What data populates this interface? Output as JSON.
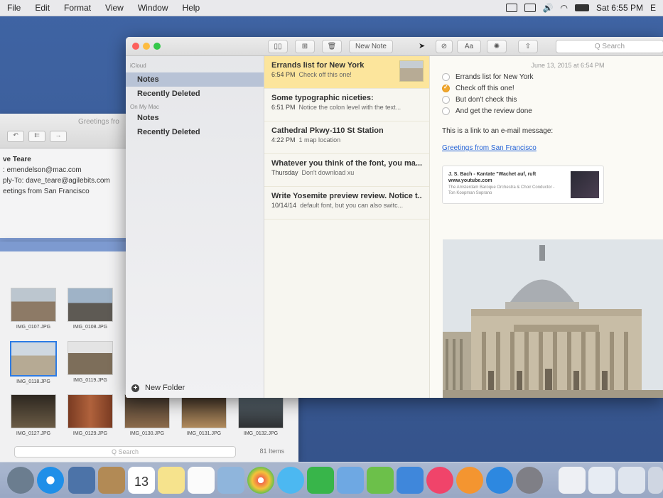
{
  "menubar": {
    "items": [
      "File",
      "Edit",
      "Format",
      "View",
      "Window",
      "Help"
    ],
    "clock": "Sat 6:55 PM",
    "extra": "E"
  },
  "mail": {
    "title": "Greetings fro",
    "from": "ve Teare",
    "to": ": emendelson@mac.com",
    "reply_to": "ply-To:  dave_teare@agilebits.com",
    "subject": "eetings from San Francisco"
  },
  "photos": {
    "items": [
      {
        "name": "IMG_0107.JPG"
      },
      {
        "name": "IMG_0108.JPG"
      },
      {
        "name": "IMG_0118.JPG"
      },
      {
        "name": "IMG_0119.JPG"
      },
      {
        "name": "IMG_0127.JPG"
      },
      {
        "name": "IMG_0129.JPG"
      },
      {
        "name": "IMG_0130.JPG"
      },
      {
        "name": "IMG_0131.JPG"
      },
      {
        "name": "IMG_0132.JPG"
      }
    ],
    "search_placeholder": "Q Search",
    "count": "81 Items"
  },
  "notes": {
    "toolbar": {
      "new_note": "New Note",
      "format": "Aa",
      "search_placeholder": "Q Search"
    },
    "sidebar": {
      "icloud_header": "iCloud",
      "icloud_items": [
        "Notes",
        "Recently Deleted"
      ],
      "mac_header": "On My Mac",
      "mac_items": [
        "Notes",
        "Recently Deleted"
      ],
      "new_folder": "New Folder"
    },
    "list": [
      {
        "title": "Errands list for New York",
        "time": "6:54 PM",
        "preview": "Check off this one!"
      },
      {
        "title": "Some typographic niceties:",
        "time": "6:51 PM",
        "preview": "Notice the colon level with the text..."
      },
      {
        "title": "Cathedral Pkwy-110 St Station",
        "time": "4:22 PM",
        "preview": "1 map location"
      },
      {
        "title": "Whatever you think of the font, you ma...",
        "time": "Thursday",
        "preview": "Don't download xu"
      },
      {
        "title": "Write Yosemite preview review. Notice t...",
        "time": "10/14/14",
        "preview": "default font, but you can also switc..."
      }
    ],
    "editor": {
      "date": "June 13, 2015 at 6:54 PM",
      "checklist": [
        {
          "text": "Errands list for New York",
          "checked": false
        },
        {
          "text": "Check off this one!",
          "checked": true
        },
        {
          "text": "But don't check this",
          "checked": false
        },
        {
          "text": "And get the review done",
          "checked": false
        }
      ],
      "paragraph": "This is a link to an e-mail message:",
      "link": "Greetings from San Francisco",
      "card": {
        "title": "J. S. Bach - Kantate \"Wachet auf, ruft",
        "url": "www.youtube.com",
        "desc": "The Amsterdam Baroque Orchestra & Choir Conductor - Ton Koopman Soprano"
      }
    }
  },
  "dock": {
    "calendar_day": "13"
  }
}
